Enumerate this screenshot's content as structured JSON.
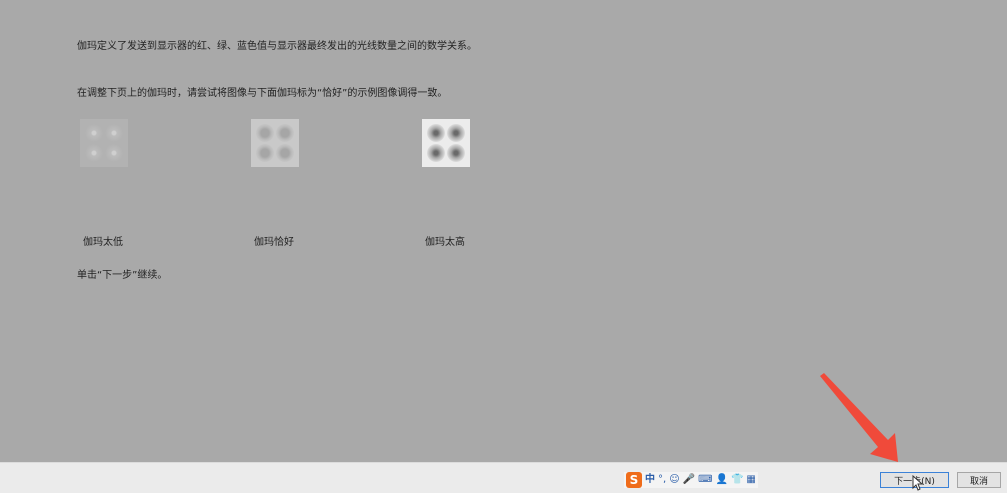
{
  "content": {
    "intro": "伽玛定义了发送到显示器的红、绿、蓝色值与显示器最终发出的光线数量之间的数学关系。",
    "instruction": "在调整下页上的伽玛时，请尝试将图像与下面伽玛标为“恰好”的示例图像调得一致。",
    "continue_hint": "单击“下一步”继续。"
  },
  "samples": {
    "low": "伽玛太低",
    "good": "伽玛恰好",
    "high": "伽玛太高"
  },
  "buttons": {
    "next": "下一步(N)",
    "cancel": "取消"
  },
  "ime": {
    "logo": "S",
    "mode": "中",
    "punct": "°,",
    "emoji": "☺",
    "mic": "🎤",
    "keyboard": "⌨",
    "user": "👤",
    "skin": "👕",
    "tools": "▦"
  },
  "colors": {
    "background": "#a9a9a9",
    "footer": "#ebebeb",
    "arrow": "#f04a3a",
    "ime_logo": "#ef6c1a"
  }
}
